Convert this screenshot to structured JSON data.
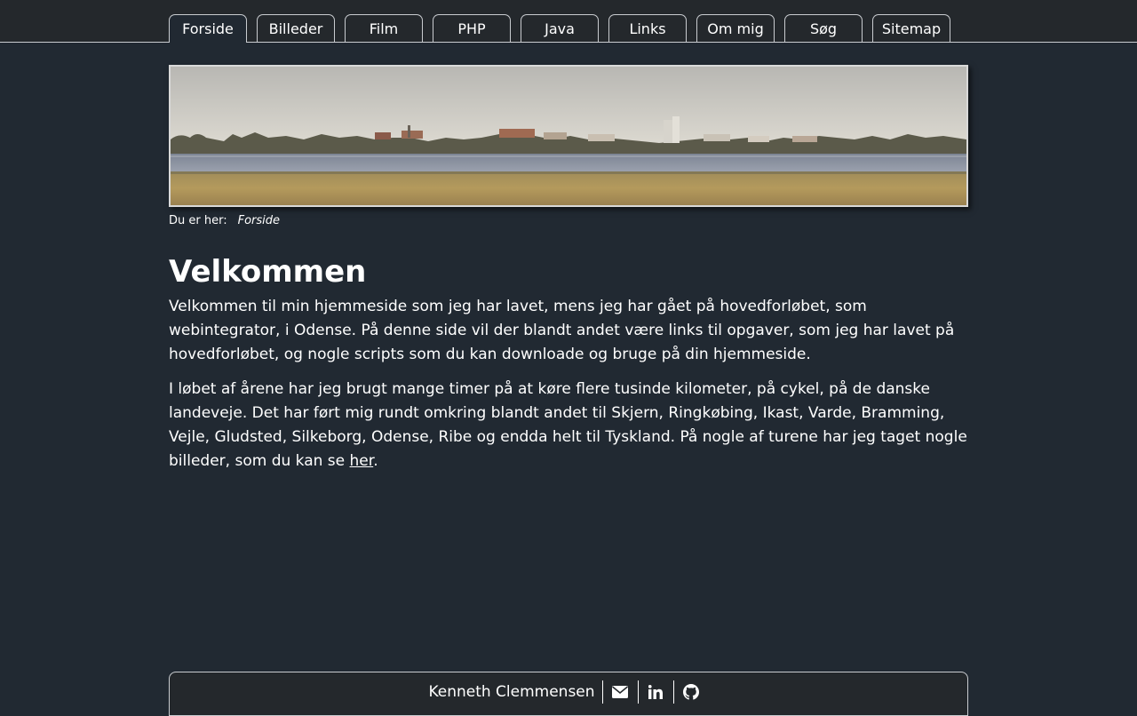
{
  "nav": {
    "tabs": [
      {
        "label": "Forside"
      },
      {
        "label": "Billeder"
      },
      {
        "label": "Film"
      },
      {
        "label": "PHP"
      },
      {
        "label": "Java"
      },
      {
        "label": "Links"
      },
      {
        "label": "Om mig"
      },
      {
        "label": "Søg"
      },
      {
        "label": "Sitemap"
      }
    ],
    "active": "Forside"
  },
  "breadcrumb": {
    "label": "Du er her:",
    "current": "Forside"
  },
  "main": {
    "title": "Velkommen",
    "paragraph1": "Velkommen til min hjemmeside som jeg har lavet, mens jeg har gået på hovedforløbet, som webintegrator, i Odense. På denne side vil der blandt andet være links til opgaver, som jeg har lavet på hovedforløbet, og nogle scripts som du kan downloade og bruge på din hjemmeside.",
    "paragraph2_text": "I løbet af årene har jeg brugt mange timer på at køre flere tusinde kilometer, på cykel, på de danske landeveje. Det har ført mig rundt omkring blandt andet til Skjern, Ringkøbing, Ikast, Varde, Bramming, Vejle, Gludsted, Silkeborg, Odense, Ribe og endda helt til Tyskland. På nogle af turene har jeg taget nogle billeder, som du kan se ",
    "paragraph2_link": "her",
    "paragraph2_end": "."
  },
  "footer": {
    "name": "Kenneth Clemmensen",
    "icons": [
      "envelope-icon",
      "linkedin-icon",
      "github-icon"
    ]
  },
  "colors": {
    "background": "#212932",
    "topbar": "#24282c",
    "border": "#c9ccd0",
    "text": "#ffffff"
  }
}
